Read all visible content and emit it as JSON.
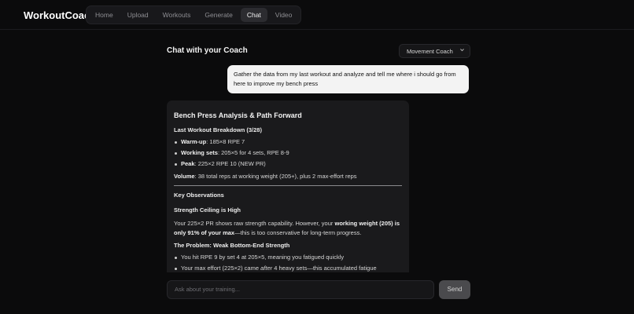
{
  "app": {
    "brand": "WorkoutCoach"
  },
  "nav": {
    "items": [
      {
        "label": "Home"
      },
      {
        "label": "Upload"
      },
      {
        "label": "Workouts"
      },
      {
        "label": "Generate"
      },
      {
        "label": "Chat"
      },
      {
        "label": "Video"
      }
    ],
    "active": "Chat"
  },
  "chat": {
    "title": "Chat with your Coach",
    "coach_select": {
      "value": "Movement Coach",
      "icon": "chevron-down-icon"
    },
    "user_message": "Gather the data from my last workout and analyze and tell me where i should go from here to improve my bench press",
    "assistant": {
      "title": "Bench Press Analysis & Path Forward",
      "breakdown_heading": "Last Workout Breakdown (3/28)",
      "breakdown": [
        {
          "label": "Warm-up",
          "text": ": 185×8 RPE 7"
        },
        {
          "label": "Working sets",
          "text": ": 205×5 for 4 sets, RPE 8-9"
        },
        {
          "label": "Peak",
          "text": ": 225×2 RPE 10 (NEW PR)"
        }
      ],
      "volume": {
        "label": "Volume",
        "text": ": 38 total reps at working weight (205+), plus 2 max-effort reps"
      },
      "observations_heading": "Key Observations",
      "ceiling_heading": "Strength Ceiling is High",
      "ceiling": {
        "pre": "Your 225×2 PR shows raw strength capability. However, your ",
        "bold": "working weight (205) is only 91% of your max",
        "post": "—this is too conservative for long-term progress."
      },
      "problem_heading": "The Problem: Weak Bottom-End Strength",
      "problem_items": [
        {
          "pre": "You hit RPE 9 by set 4 at 205×5, meaning you fatigued quickly",
          "em": "",
          "post": ""
        },
        {
          "pre": "Your max effort (225×2) came ",
          "em": "after",
          "post": " 4 heavy sets—this accumulated fatigue"
        }
      ]
    },
    "input": {
      "placeholder": "Ask about your training..."
    },
    "send_label": "Send"
  }
}
